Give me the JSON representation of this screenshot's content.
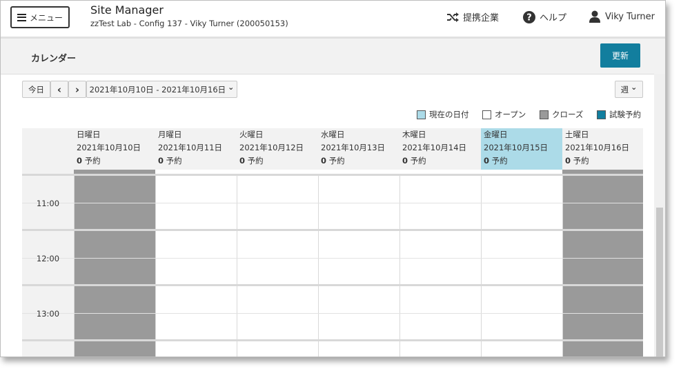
{
  "header": {
    "menu_label": "メニュー",
    "app_title": "Site Manager",
    "app_subtitle": "zzTest Lab - Config 137 - Viky Turner (200050153)",
    "partners_label": "提携企業",
    "help_label": "ヘルプ",
    "user_name": "Viky Turner"
  },
  "page": {
    "title": "カレンダー",
    "update_label": "更新"
  },
  "toolbar": {
    "today_label": "今日",
    "prev_icon": "chevron-left-icon",
    "next_icon": "chevron-right-icon",
    "prev_glyph": "‹",
    "next_glyph": "›",
    "date_range": "2021年10月10日 - 2021年10月16日",
    "caret": "⌄",
    "view_value": "週",
    "view_caret": "⌄"
  },
  "legend": [
    {
      "label": "現在の日付",
      "color": "#acdbe8"
    },
    {
      "label": "オープン",
      "color": "#ffffff"
    },
    {
      "label": "クローズ",
      "color": "#9a9a9a"
    },
    {
      "label": "試験予約",
      "color": "#127e9e"
    }
  ],
  "days": [
    {
      "weekday": "日曜日",
      "date": "2021年10月10日",
      "count": "0",
      "count_suffix": " 予約",
      "status": "closed"
    },
    {
      "weekday": "月曜日",
      "date": "2021年10月11日",
      "count": "0",
      "count_suffix": " 予約",
      "status": "open"
    },
    {
      "weekday": "火曜日",
      "date": "2021年10月12日",
      "count": "0",
      "count_suffix": " 予約",
      "status": "open"
    },
    {
      "weekday": "水曜日",
      "date": "2021年10月13日",
      "count": "0",
      "count_suffix": " 予約",
      "status": "open"
    },
    {
      "weekday": "木曜日",
      "date": "2021年10月14日",
      "count": "0",
      "count_suffix": " 予約",
      "status": "open"
    },
    {
      "weekday": "金曜日",
      "date": "2021年10月15日",
      "count": "0",
      "count_suffix": " 予約",
      "status": "open",
      "today": true
    },
    {
      "weekday": "土曜日",
      "date": "2021年10月16日",
      "count": "0",
      "count_suffix": " 予約",
      "status": "closed"
    }
  ],
  "times": [
    "11:00",
    "12:00",
    "13:00"
  ]
}
